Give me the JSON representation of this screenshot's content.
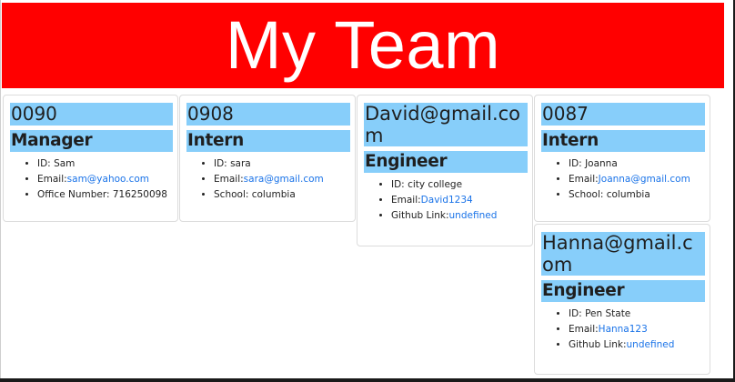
{
  "header": {
    "title": "My Team"
  },
  "cards": [
    {
      "heading": "0090",
      "role": "Manager",
      "id_label": "ID: ",
      "id_value": "Sam",
      "email_label": "Email:",
      "email_value": "sam@yahoo.com",
      "extra_label": "Office Number: ",
      "extra_value": "716250098"
    },
    {
      "heading": "0908",
      "role": "Intern",
      "id_label": "ID: ",
      "id_value": "sara",
      "email_label": "Email:",
      "email_value": "sara@gmail.com",
      "extra_label": "School: ",
      "extra_value": "columbia"
    },
    {
      "heading": "David@gmail.com",
      "role": "Engineer",
      "id_label": "ID: ",
      "id_value": "city college",
      "email_label": "Email:",
      "email_value": "David1234",
      "extra_label": "Github Link:",
      "extra_value": "undefined"
    },
    {
      "heading": "0087",
      "role": "Intern",
      "id_label": "ID: ",
      "id_value": "Joanna",
      "email_label": "Email:",
      "email_value": "Joanna@gmail.com",
      "extra_label": "School: ",
      "extra_value": "columbia"
    },
    {
      "heading": "Hanna@gmail.com",
      "role": "Engineer",
      "id_label": "ID: ",
      "id_value": "Pen State",
      "email_label": "Email:",
      "email_value": "Hanna123",
      "extra_label": "Github Link:",
      "extra_value": "undefined"
    }
  ],
  "colors": {
    "banner": "#ff0000",
    "card_heading": "#87cefa",
    "link": "#1a73e8"
  }
}
